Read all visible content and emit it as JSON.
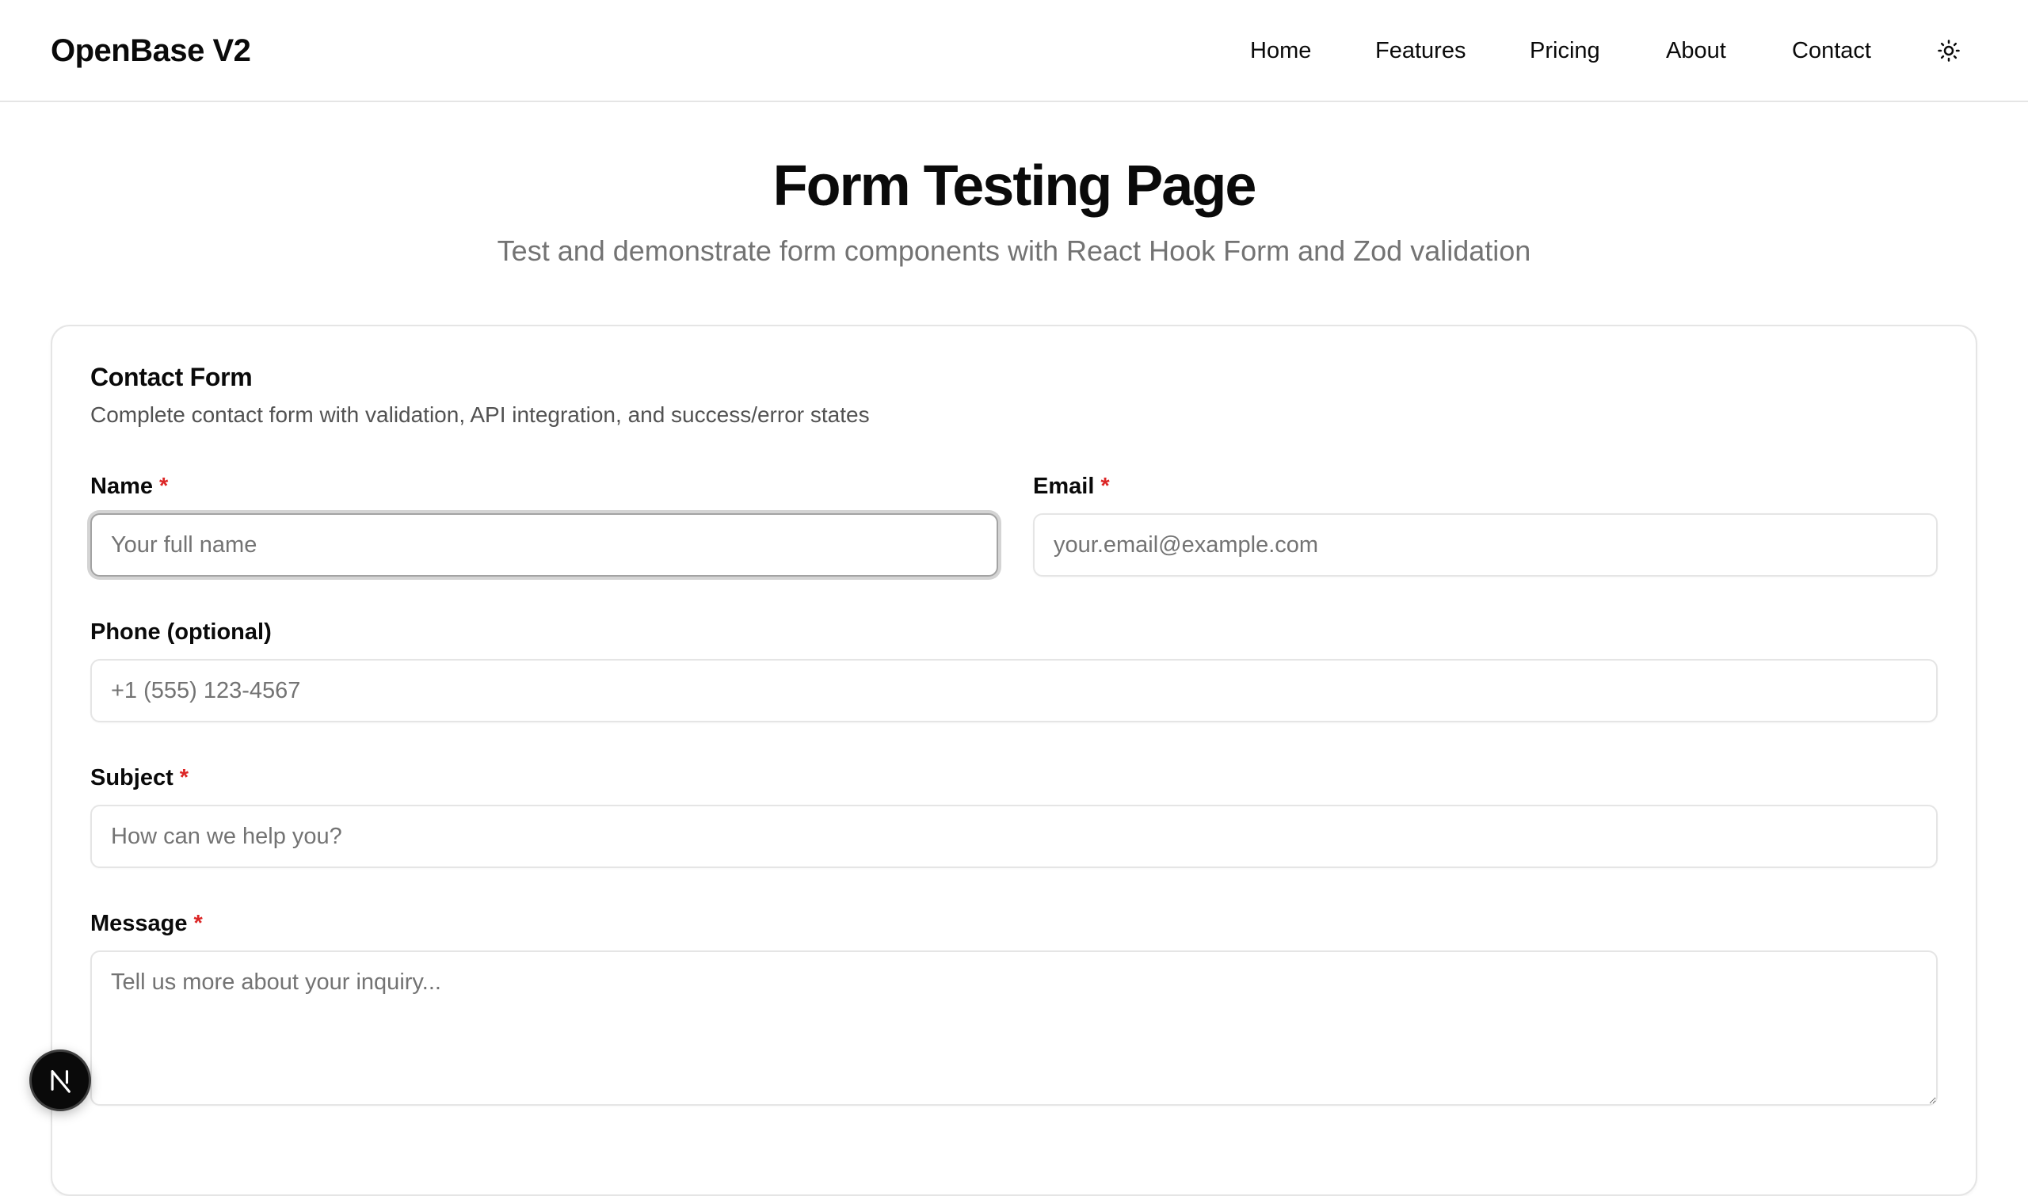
{
  "header": {
    "brand": "OpenBase V2",
    "nav": [
      "Home",
      "Features",
      "Pricing",
      "About",
      "Contact"
    ],
    "theme_toggle_icon": "sun-icon"
  },
  "hero": {
    "title": "Form Testing Page",
    "subtitle": "Test and demonstrate form components with React Hook Form and Zod validation"
  },
  "form": {
    "title": "Contact Form",
    "description": "Complete contact form with validation, API integration, and success/error states",
    "required_mark": "*",
    "fields": {
      "name": {
        "label": "Name",
        "placeholder": "Your full name",
        "value": ""
      },
      "email": {
        "label": "Email",
        "placeholder": "your.email@example.com",
        "value": ""
      },
      "phone": {
        "label": "Phone (optional)",
        "placeholder": "+1 (555) 123-4567",
        "value": ""
      },
      "subject": {
        "label": "Subject",
        "placeholder": "How can we help you?",
        "value": ""
      },
      "message": {
        "label": "Message",
        "placeholder": "Tell us more about your inquiry...",
        "value": ""
      }
    }
  },
  "dev_indicator": {
    "icon": "nextjs-logo-icon"
  },
  "colors": {
    "required": "#dc2626",
    "muted_text": "#737373",
    "border": "#e5e5e5",
    "focus_ring": "#d4d4d4"
  }
}
